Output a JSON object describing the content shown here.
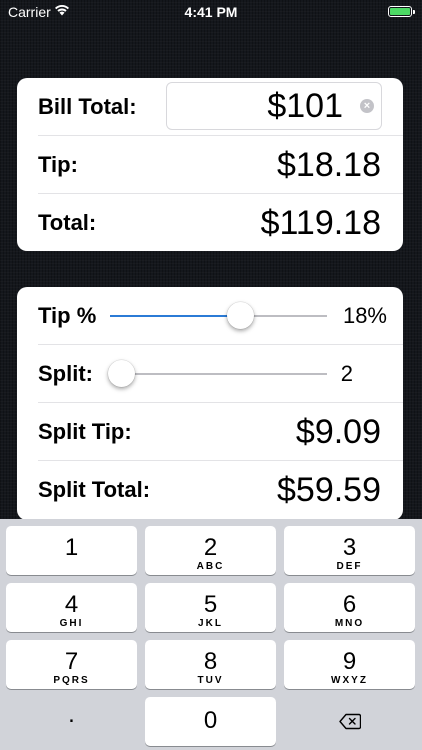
{
  "status_bar": {
    "carrier": "Carrier",
    "time": "4:41 PM",
    "battery_color": "#4cd964"
  },
  "bill": {
    "label": "Bill Total:",
    "input_value": "$101",
    "clear_icon": "clear-icon",
    "tip_label": "Tip:",
    "tip_value": "$18.18",
    "total_label": "Total:",
    "total_value": "$119.18"
  },
  "controls": {
    "tip_percent_label": "Tip %",
    "tip_percent_value": "18%",
    "tip_slider_fraction": 0.6,
    "split_label": "Split:",
    "split_value": "2",
    "split_slider_fraction": 0.05,
    "split_tip_label": "Split Tip:",
    "split_tip_value": "$9.09",
    "split_total_label": "Split Total:",
    "split_total_value": "$59.59",
    "accent_color": "#2b7bd6"
  },
  "keypad": {
    "keys": [
      {
        "num": "1",
        "letters": ""
      },
      {
        "num": "2",
        "letters": "ABC"
      },
      {
        "num": "3",
        "letters": "DEF"
      },
      {
        "num": "4",
        "letters": "GHI"
      },
      {
        "num": "5",
        "letters": "JKL"
      },
      {
        "num": "6",
        "letters": "MNO"
      },
      {
        "num": "7",
        "letters": "PQRS"
      },
      {
        "num": "8",
        "letters": "TUV"
      },
      {
        "num": "9",
        "letters": "WXYZ"
      },
      {
        "num": ".",
        "letters": ""
      },
      {
        "num": "0",
        "letters": ""
      }
    ],
    "delete_icon": "backspace-icon"
  }
}
